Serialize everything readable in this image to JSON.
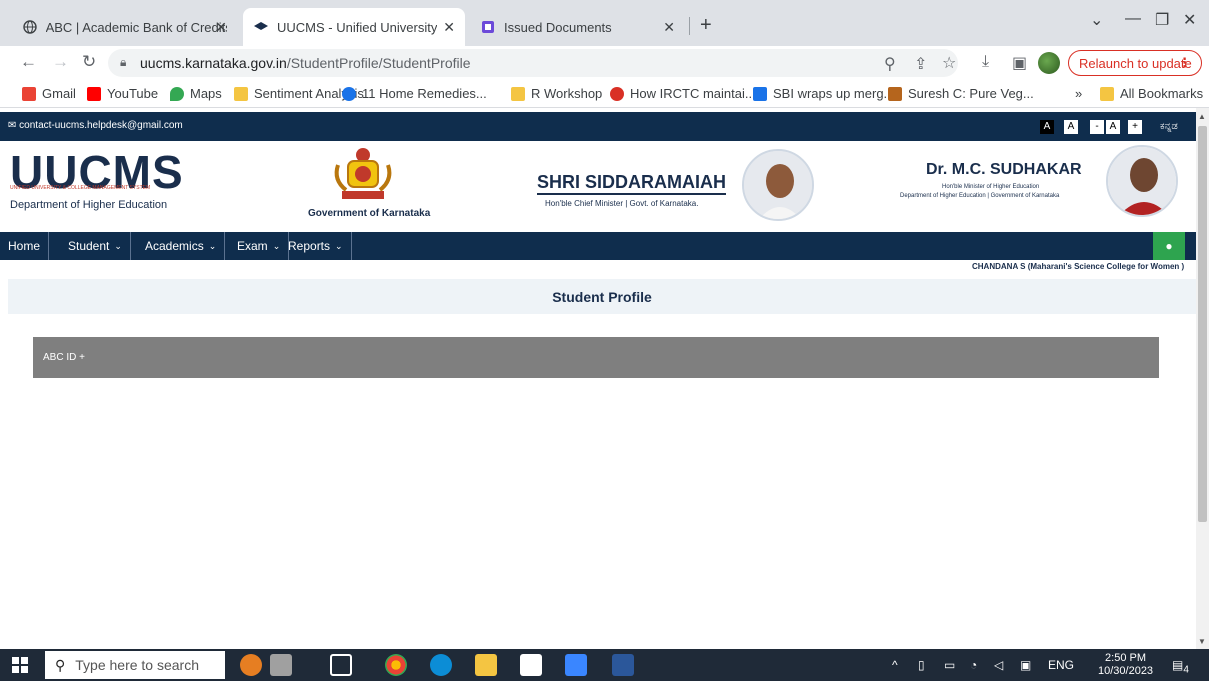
{
  "browser": {
    "tabs": [
      {
        "title": "ABC | Academic Bank of Credits",
        "active": false
      },
      {
        "title": "UUCMS - Unified University Coll",
        "active": true
      },
      {
        "title": "Issued Documents",
        "active": false
      }
    ],
    "url_host": "uucms.karnataka.gov.in",
    "url_path": "/StudentProfile/StudentProfile",
    "relaunch_label": "Relaunch to update",
    "bookmarks": [
      {
        "label": "Gmail",
        "color": "#ea4335"
      },
      {
        "label": "YouTube",
        "color": "#ff0000"
      },
      {
        "label": "Maps",
        "color": "#34a853"
      },
      {
        "label": "Sentiment Analysis",
        "color": "#f4c542"
      },
      {
        "label": "11 Home Remedies...",
        "color": "#1a73e8"
      },
      {
        "label": "R Workshop",
        "color": "#f4c542"
      },
      {
        "label": "How IRCTC maintai...",
        "color": "#d93025"
      },
      {
        "label": "SBI wraps up merg...",
        "color": "#1a73e8"
      },
      {
        "label": "Suresh C: Pure Veg...",
        "color": "#b5651d"
      }
    ],
    "all_bookmarks_label": "All Bookmarks",
    "more_bookmarks": "»"
  },
  "site": {
    "email": "contact-uucms.helpdesk@gmail.com",
    "font_controls": [
      "A",
      "A",
      "-",
      "A",
      "+"
    ],
    "language_toggle": "ಕನ್ನಡ",
    "logo_text": "UUCMS",
    "logo_subtitle": "UNIFIED UNIVERSITY & COLLEGE MANAGEMENT SYSTEM",
    "department": "Department of Higher Education",
    "government": "Government of Karnataka",
    "cm_name": "SHRI SIDDARAMAIAH",
    "cm_title": "Hon'ble Chief Minister  |  Govt. of Karnataka.",
    "minister_name": "Dr. M.C. SUDHAKAR",
    "minister_title": "Hon'ble Minister of Higher Education",
    "minister_dept": "Department of Higher Education | Government of Karnataka",
    "nav": [
      {
        "label": "Home",
        "dropdown": false
      },
      {
        "label": "Student",
        "dropdown": true
      },
      {
        "label": "Academics",
        "dropdown": true
      },
      {
        "label": "Exam",
        "dropdown": true
      },
      {
        "label": "Reports",
        "dropdown": true
      }
    ],
    "user_label": "CHANDANA S (Maharani's Science College for Women )",
    "page_title": "Student Profile",
    "abc_label": "ABC ID +"
  },
  "taskbar": {
    "search_placeholder": "Type here to search",
    "language": "ENG",
    "time": "2:50 PM",
    "date": "10/30/2023",
    "notifications": "4"
  }
}
